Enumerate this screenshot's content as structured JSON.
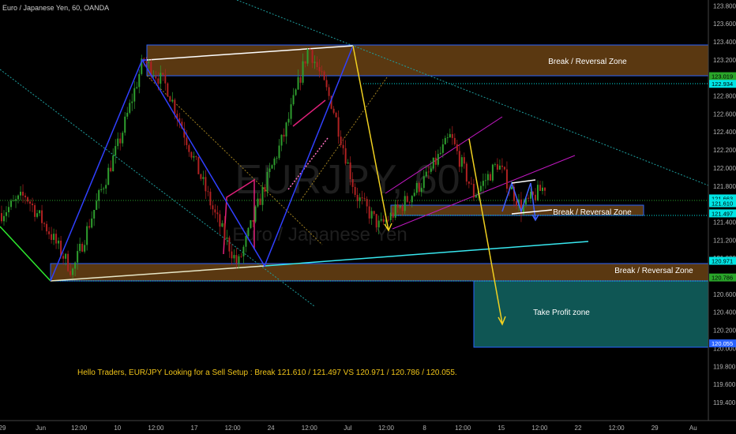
{
  "header": {
    "symbol_line": "Euro / Japanese Yen, 60, OANDA"
  },
  "watermark": {
    "ticker": "EURJPY, 60",
    "name": "Euro / Japanese Yen"
  },
  "note": "Hello Traders, EUR/JPY Looking for a Sell Setup : Break 121.610 / 121.497 VS 120.971 / 120.786 / 120.055.",
  "zones": {
    "upper_label": "Break / Reversal Zone",
    "middle_label": "Break / Reversal Zone",
    "lower_label": "Break / Reversal Zone",
    "tp_label": "Take Profit zone"
  },
  "colors": {
    "background": "#000000",
    "zone_fill": "#5a3811",
    "tp_fill": "#0f5654",
    "candle_up": "#2e9e2e",
    "candle_down": "#b02222",
    "label_text": "#ffffff",
    "note_text": "#f0c419",
    "axis_text": "#b0b0b0"
  },
  "chart_data": {
    "type": "candlestick",
    "symbol": "Euro / Japanese Yen, 60, OANDA",
    "ylim": [
      119.33,
      123.82
    ],
    "y_ticks": [
      "123.800",
      "123.600",
      "123.400",
      "123.200",
      "123.000",
      "122.800",
      "122.600",
      "122.400",
      "122.200",
      "122.000",
      "121.800",
      "121.600",
      "121.400",
      "121.200",
      "121.000",
      "120.800",
      "120.600",
      "120.400",
      "120.200",
      "120.000",
      "119.800",
      "119.600",
      "119.400"
    ],
    "x_ticks": [
      "29",
      "Jun",
      "12:00",
      "10",
      "12:00",
      "17",
      "12:00",
      "24",
      "12:00",
      "Jul",
      "12:00",
      "8",
      "12:00",
      "15",
      "12:00",
      "22",
      "12:00",
      "29",
      "Au"
    ],
    "price_tags": [
      {
        "value": "123.019",
        "color": "#2aa52a",
        "level": 123.019
      },
      {
        "value": "122.934",
        "color": "#00e5e5",
        "level": 122.934
      },
      {
        "value": "121.663",
        "color": "#00e5e5",
        "level": 121.663
      },
      {
        "value": "121.610",
        "color": "#00e5e5",
        "level": 121.61
      },
      {
        "value": "121.497",
        "color": "#00e5e5",
        "level": 121.497
      },
      {
        "value": "120.971",
        "color": "#00e5e5",
        "level": 120.971
      },
      {
        "value": "120.786",
        "color": "#2aa52a",
        "level": 120.786
      },
      {
        "value": "120.055",
        "color": "#2962ff",
        "level": 120.055
      }
    ],
    "zones": [
      {
        "name": "upper_label",
        "from": 123.019,
        "to": 123.35
      },
      {
        "name": "middle_label",
        "from": 121.497,
        "to": 121.61
      },
      {
        "name": "lower_label",
        "from": 120.786,
        "to": 120.971
      },
      {
        "name": "tp_label",
        "from": 120.055,
        "to": 120.786
      }
    ],
    "path_prices": [
      121.5,
      121.7,
      121.3,
      120.85,
      121.6,
      122.3,
      123.2,
      122.9,
      122.2,
      121.5,
      120.92,
      121.7,
      122.4,
      123.35,
      122.7,
      121.7,
      121.35,
      121.6,
      121.9,
      122.35,
      121.7,
      122.05,
      121.55,
      121.8
    ]
  }
}
